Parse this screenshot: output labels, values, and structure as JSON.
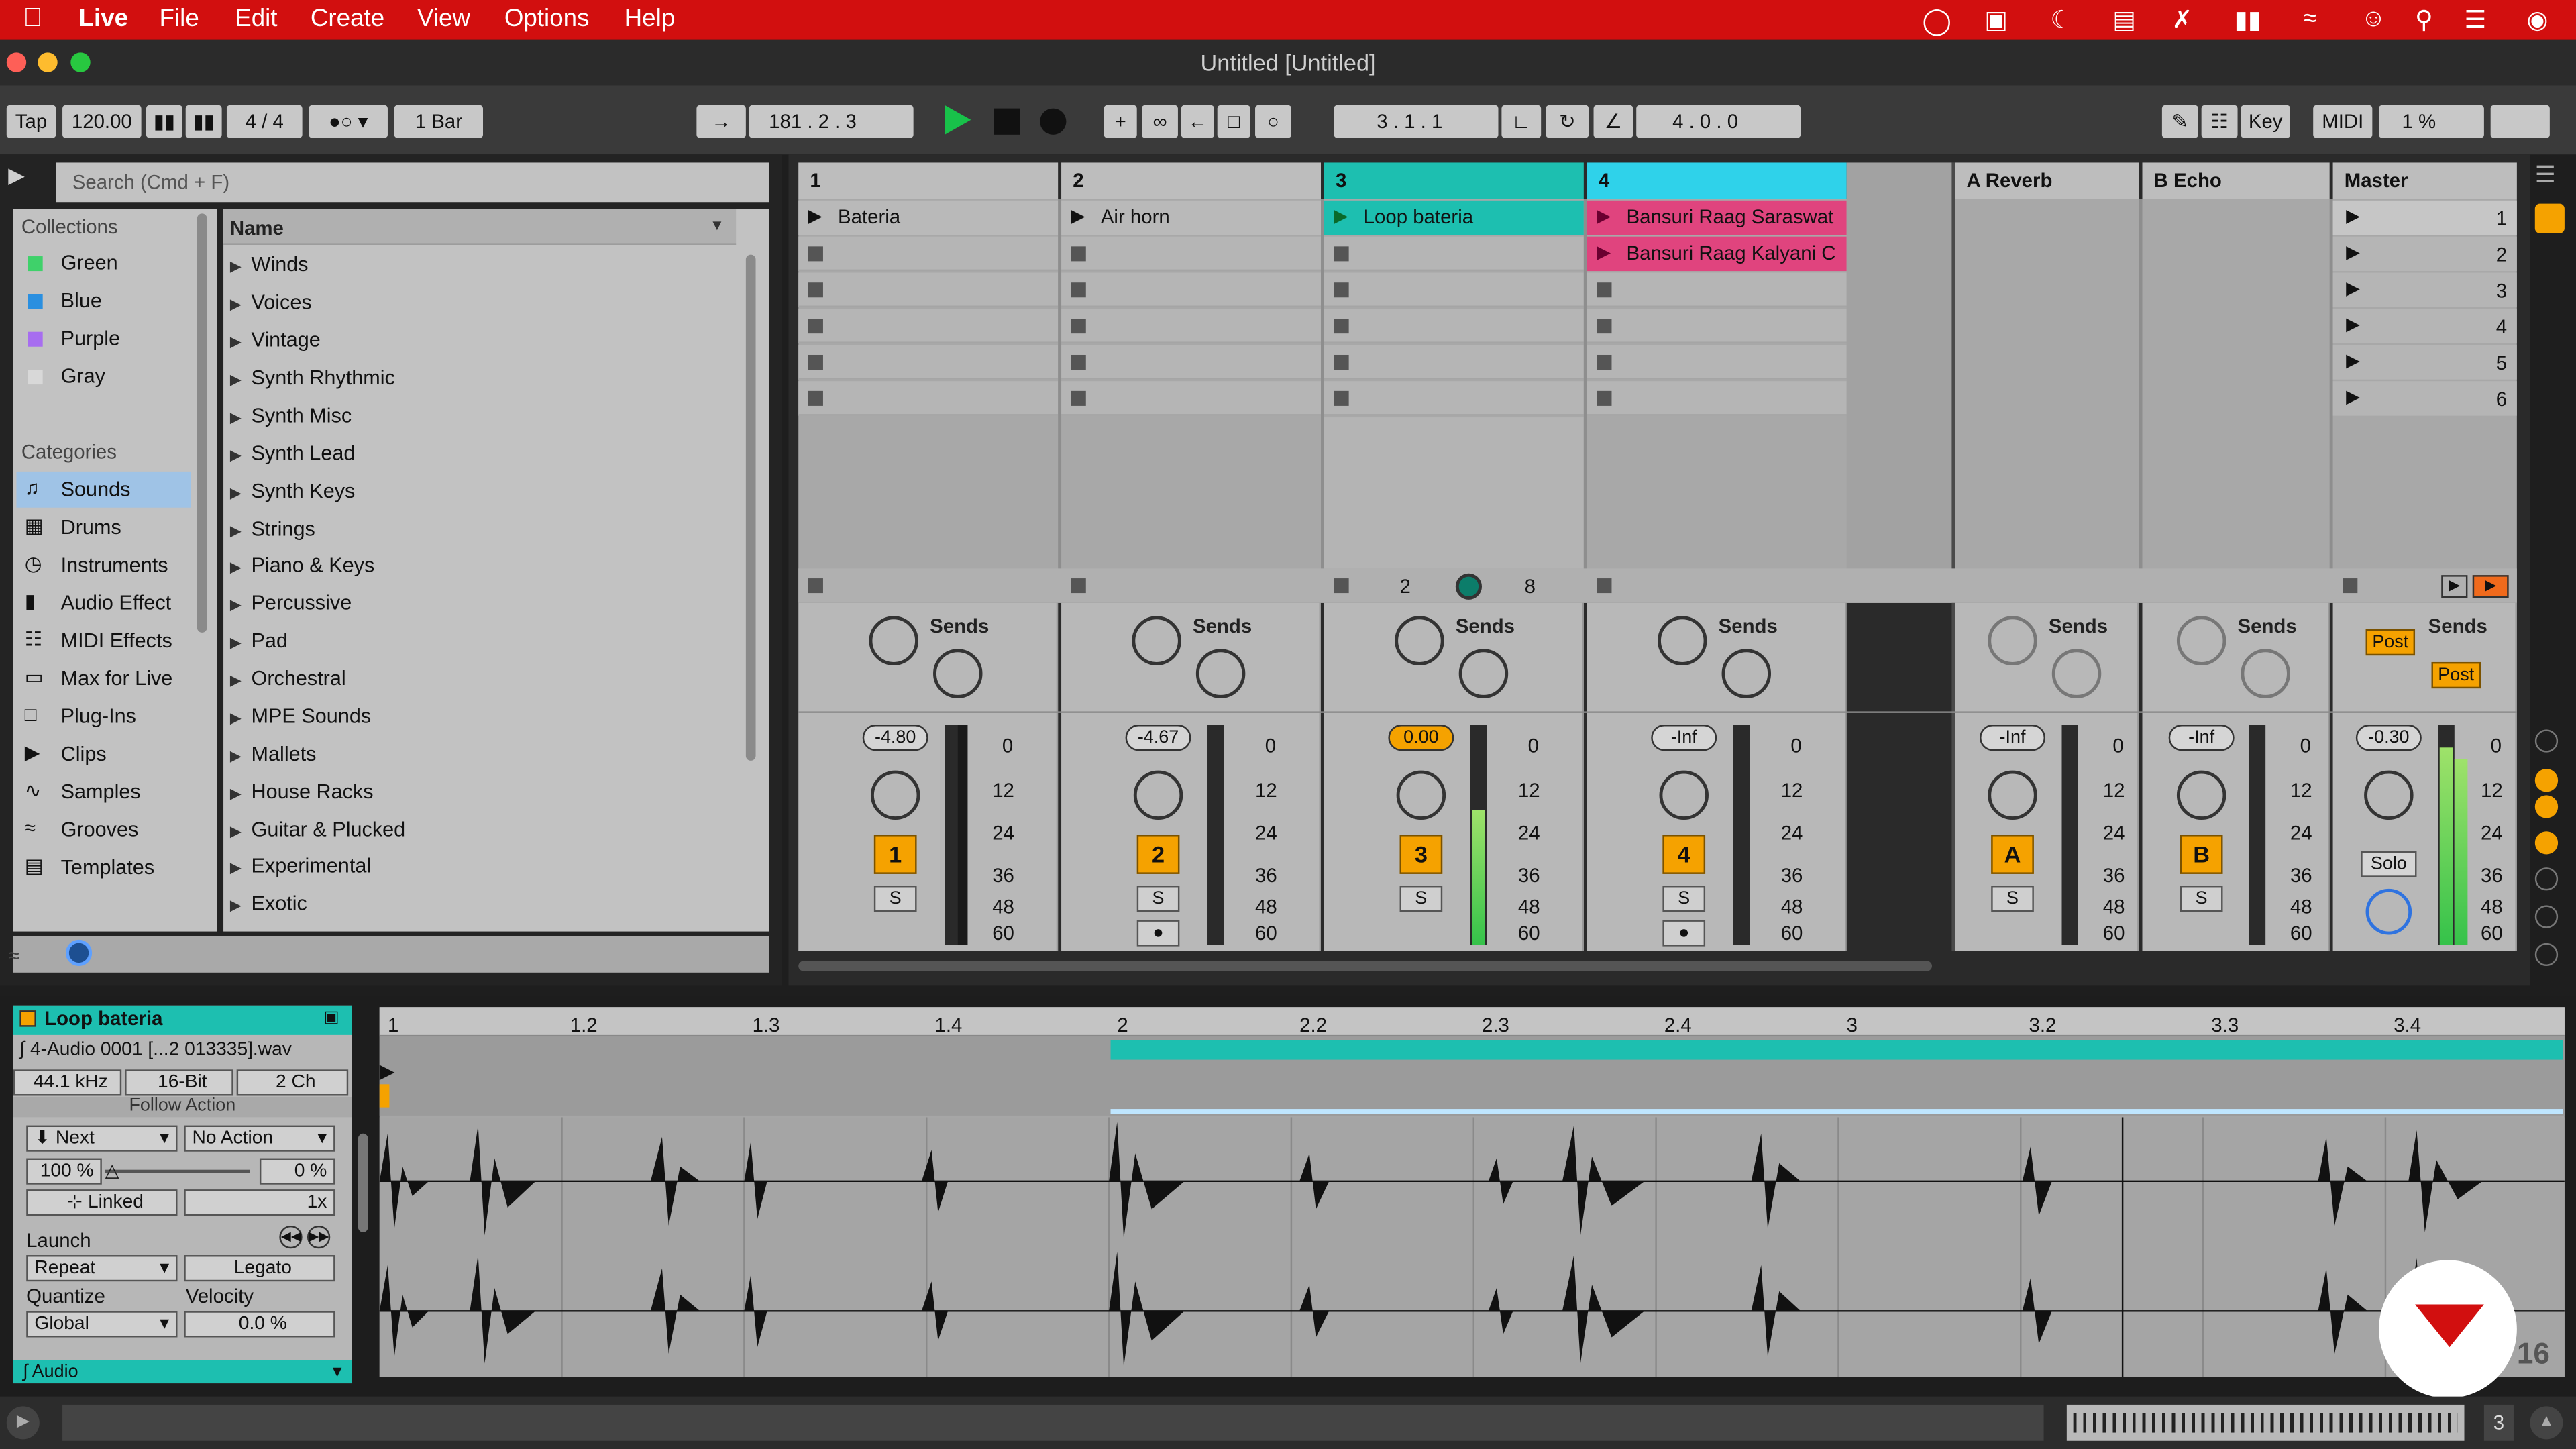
{
  "menubar": {
    "app_name": "Live",
    "items": [
      "File",
      "Edit",
      "Create",
      "View",
      "Options",
      "Help"
    ]
  },
  "window": {
    "title": "Untitled  [Untitled]"
  },
  "transport": {
    "tap": "Tap",
    "tempo": "120.00",
    "time_signature": "4 / 4",
    "quantization": "1 Bar",
    "arrangement_position": "181 .   2 .   3",
    "song_position": "3 .   1 .   1",
    "loop_length": "4 .   0 .   0",
    "key": "Key",
    "midi": "MIDI",
    "cpu": "1 %"
  },
  "browser": {
    "search_placeholder": "Search (Cmd + F)",
    "collections_title": "Collections",
    "collections": [
      {
        "label": "Green",
        "color": "#3fd16a"
      },
      {
        "label": "Blue",
        "color": "#2a8fe0"
      },
      {
        "label": "Purple",
        "color": "#a76df0"
      },
      {
        "label": "Gray",
        "color": "#9a9a9a"
      }
    ],
    "categories_title": "Categories",
    "categories": [
      "Sounds",
      "Drums",
      "Instruments",
      "Audio Effect",
      "MIDI Effects",
      "Max for Live",
      "Plug-Ins",
      "Clips",
      "Samples",
      "Grooves",
      "Templates"
    ],
    "column_header": "Name",
    "items": [
      "Winds",
      "Voices",
      "Vintage",
      "Synth Rhythmic",
      "Synth Misc",
      "Synth Lead",
      "Synth Keys",
      "Strings",
      "Piano & Keys",
      "Percussive",
      "Pad",
      "Orchestral",
      "MPE Sounds",
      "Mallets",
      "House Racks",
      "Guitar & Plucked",
      "Experimental",
      "Exotic"
    ]
  },
  "tracks": [
    {
      "number": "1",
      "clip": "Bateria",
      "volume": "-4.80",
      "track_button": "1",
      "solo": "S"
    },
    {
      "number": "2",
      "clip": "Air horn",
      "volume": "-4.67",
      "track_button": "2",
      "solo": "S"
    },
    {
      "number": "3",
      "clip": "Loop bateria",
      "volume": "0.00",
      "track_button": "3",
      "solo": "S",
      "stop_left": "2",
      "stop_right": "8"
    },
    {
      "number": "4",
      "clip": "Bansuri Raag Saraswat",
      "clip2": "Bansuri Raag Kalyani C",
      "volume": "-Inf",
      "track_button": "4",
      "solo": "S"
    }
  ],
  "returns": [
    {
      "name": "A Reverb",
      "volume": "-Inf",
      "track_button": "A",
      "solo": "S"
    },
    {
      "name": "B Echo",
      "volume": "-Inf",
      "track_button": "B",
      "solo": "S"
    }
  ],
  "master": {
    "name": "Master",
    "volume": "-0.30",
    "solo": "Solo",
    "post1": "Post",
    "post2": "Post",
    "scenes": [
      "1",
      "2",
      "3",
      "4",
      "5",
      "6"
    ]
  },
  "mixer_labels": {
    "sends": "Sends",
    "send_a": "A",
    "send_b": "B",
    "scale": [
      "0",
      "12",
      "24",
      "36",
      "48",
      "60"
    ]
  },
  "clip_view": {
    "clip_name": "Loop bateria",
    "file": "4-Audio 0001 [...2 013335].wav",
    "sample_rate": "44.1 kHz",
    "bit_depth": "16-Bit",
    "channels": "2 Ch",
    "follow_action_label": "Follow Action",
    "follow_next": "Next",
    "follow_other": "No Action",
    "chance_left": "100 %",
    "chance_right": "0 %",
    "linked": "Linked",
    "multiplier": "1x",
    "launch_label": "Launch",
    "launch_mode": "Repeat",
    "legato": "Legato",
    "quantize_label": "Quantize",
    "velocity_label": "Velocity",
    "quantize": "Global",
    "velocity": "0.0 %",
    "audio_section": "Audio",
    "ruler": [
      "1",
      "1.2",
      "1.3",
      "1.4",
      "2",
      "2.2",
      "2.3",
      "2.4",
      "3",
      "3.2",
      "3.3",
      "3.4"
    ],
    "corner_number": "16"
  },
  "status": {
    "right_number": "3"
  },
  "colors": {
    "menubar": "#d20f0f",
    "track3": "#1dbfb0",
    "track4": "#2fd2ea",
    "clip_pink": "#e0447e",
    "orange": "#f5a200",
    "play_green": "#18c24a"
  }
}
